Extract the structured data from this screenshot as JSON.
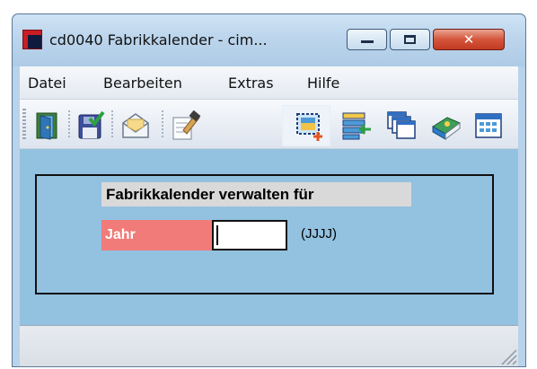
{
  "window": {
    "title": "cd0040 Fabrikkalender - cim...",
    "minimize_icon": "minimize-icon",
    "maximize_icon": "maximize-icon",
    "close_glyph": "✕"
  },
  "menubar": {
    "items": [
      {
        "label": "Datei"
      },
      {
        "label": "Bearbeiten"
      },
      {
        "label": "Extras"
      },
      {
        "label": "Hilfe"
      }
    ]
  },
  "toolbar": {
    "icons": [
      {
        "name": "exit-door-icon"
      },
      {
        "name": "save-check-icon"
      },
      {
        "name": "mail-envelope-icon"
      },
      {
        "name": "edit-properties-icon"
      },
      {
        "name": "new-selection-icon"
      },
      {
        "name": "list-transfer-icon"
      },
      {
        "name": "windows-cascade-icon"
      },
      {
        "name": "book-icon"
      },
      {
        "name": "calendar-grid-icon"
      }
    ]
  },
  "form": {
    "header": "Fabrikkalender verwalten für",
    "year_label": "Jahr",
    "year_value": "",
    "format_hint": "(JJJJ)"
  },
  "statusbar": {
    "text": ""
  },
  "colors": {
    "client_bg": "#93c1e0",
    "label_bg": "#f07b79",
    "header_bg": "#d9d9d9",
    "close_button": "#c23a22"
  }
}
